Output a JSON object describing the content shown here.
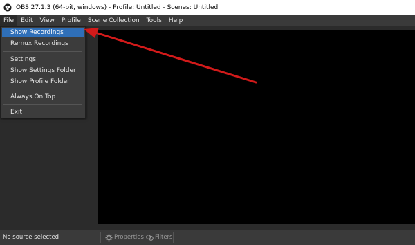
{
  "window": {
    "title": "OBS 27.1.3 (64-bit, windows) - Profile: Untitled - Scenes: Untitled"
  },
  "menubar": {
    "items": [
      {
        "label": "File"
      },
      {
        "label": "Edit"
      },
      {
        "label": "View"
      },
      {
        "label": "Profile"
      },
      {
        "label": "Scene Collection"
      },
      {
        "label": "Tools"
      },
      {
        "label": "Help"
      }
    ]
  },
  "file_menu": {
    "items": [
      {
        "label": "Show Recordings"
      },
      {
        "label": "Remux Recordings"
      },
      {
        "label": "Settings"
      },
      {
        "label": "Show Settings Folder"
      },
      {
        "label": "Show Profile Folder"
      },
      {
        "label": "Always On Top"
      },
      {
        "label": "Exit"
      }
    ]
  },
  "statusbar": {
    "source_status": "No source selected",
    "properties_label": "Properties",
    "filters_label": "Filters"
  },
  "colors": {
    "highlight": "#2f6fb8",
    "annotation_arrow": "#d21a1a"
  }
}
